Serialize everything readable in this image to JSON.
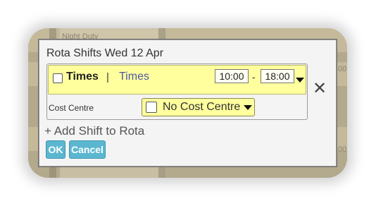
{
  "background": {
    "row_text": "Night Duty",
    "right_text_1": "00",
    "right_text_2": "00"
  },
  "dialog": {
    "title": "Rota Shifts Wed 12 Apr",
    "shift": {
      "checked": false,
      "name": "Times",
      "separator": "|",
      "type": "Times",
      "start_time": "10:00",
      "time_separator": "-",
      "end_time": "18:00"
    },
    "cost_centre": {
      "label": "Cost Centre",
      "checked": false,
      "value": "No Cost Centre"
    },
    "add_shift_label": "+ Add Shift to Rota",
    "ok_label": "OK",
    "cancel_label": "Cancel"
  },
  "colors": {
    "highlight_yellow": "#ffff9e",
    "button_blue": "#5bb7d0",
    "link_blue": "#4d57a8"
  }
}
